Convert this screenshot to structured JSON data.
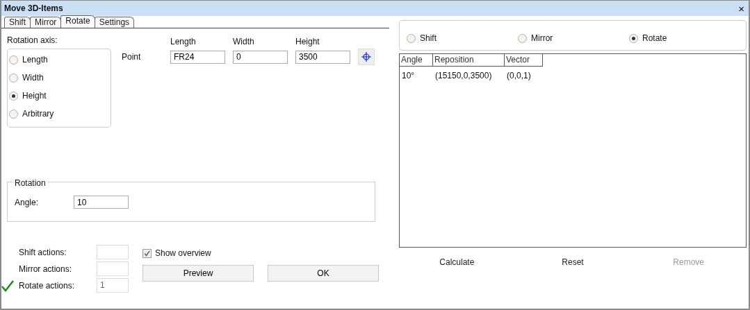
{
  "window": {
    "title": "Move 3D-Items",
    "close": "×"
  },
  "tabs": [
    {
      "label": "Shift",
      "selected": false
    },
    {
      "label": "Mirror",
      "selected": false
    },
    {
      "label": "Rotate",
      "selected": true
    },
    {
      "label": "Settings",
      "selected": false
    }
  ],
  "rotation_axis": {
    "label": "Rotation axis:",
    "options": [
      {
        "label": "Length",
        "selected": false
      },
      {
        "label": "Width",
        "selected": false
      },
      {
        "label": "Height",
        "selected": true
      },
      {
        "label": "Arbitrary",
        "selected": false
      }
    ]
  },
  "point": {
    "label": "Point",
    "columns": [
      "Length",
      "Width",
      "Height"
    ],
    "values": [
      "FR24",
      "0",
      "3500"
    ]
  },
  "rotation": {
    "legend": "Rotation",
    "angle_label": "Angle:",
    "angle": "10"
  },
  "actions": [
    {
      "label": "Shift actions:",
      "done": false
    },
    {
      "label": "Mirror actions:",
      "done": false
    },
    {
      "label": "Rotate actions:",
      "done": true,
      "value": "1"
    }
  ],
  "show_overview": {
    "label": "Show overview",
    "checked": true
  },
  "buttons": [
    "Preview",
    "OK"
  ],
  "mode": [
    {
      "label": "Shift",
      "selected": false
    },
    {
      "label": "Mirror",
      "selected": false
    },
    {
      "label": "Rotate",
      "selected": true
    }
  ],
  "table": {
    "columns": [
      "Angle",
      "Reposition",
      "Vector"
    ],
    "rows": [
      [
        "10°",
        "(15150,0,3500)",
        "(0,0,1)"
      ]
    ]
  },
  "commands": [
    {
      "label": "Calculate",
      "disabled": false
    },
    {
      "label": "Reset",
      "disabled": false
    },
    {
      "label": "Remove",
      "disabled": true
    }
  ]
}
